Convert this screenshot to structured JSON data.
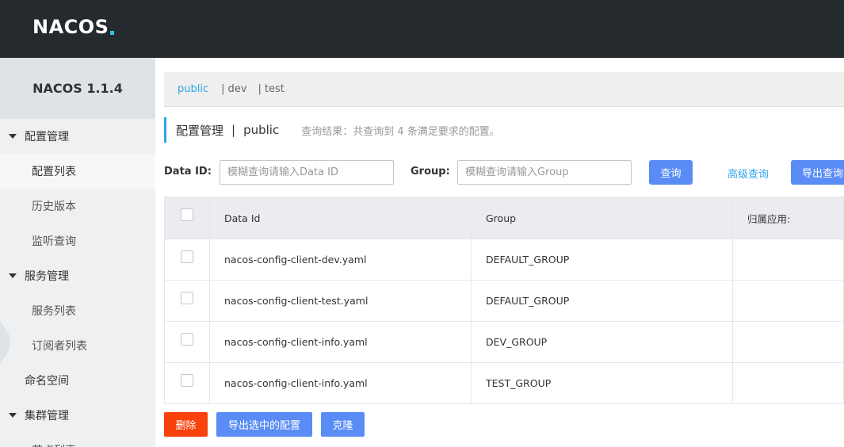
{
  "header": {
    "logo_text": "NACOS"
  },
  "sidebar": {
    "title": "NACOS 1.1.4",
    "config_group": "配置管理",
    "config_items": [
      "配置列表",
      "历史版本",
      "监听查询"
    ],
    "service_group": "服务管理",
    "service_items": [
      "服务列表",
      "订阅者列表"
    ],
    "namespace": "命名空间",
    "cluster_group": "集群管理",
    "cluster_items": [
      "节点列表"
    ]
  },
  "namespaces": {
    "items": [
      "public",
      "dev",
      "test"
    ],
    "active": "public"
  },
  "page": {
    "title": "配置管理",
    "separator": "|",
    "namespace": "public",
    "result": "查询结果：共查询到 4 条满足要求的配置。"
  },
  "search": {
    "dataid_label": "Data ID:",
    "dataid_placeholder": "模糊查询请输入Data ID",
    "group_label": "Group:",
    "group_placeholder": "模糊查询请输入Group",
    "query_btn": "查询",
    "advanced_link": "高级查询",
    "export_btn": "导出查询"
  },
  "table": {
    "columns": [
      "Data Id",
      "Group",
      "归属应用:"
    ],
    "rows": [
      {
        "data_id": "nacos-config-client-dev.yaml",
        "group": "DEFAULT_GROUP",
        "app": ""
      },
      {
        "data_id": "nacos-config-client-test.yaml",
        "group": "DEFAULT_GROUP",
        "app": ""
      },
      {
        "data_id": "nacos-config-client-info.yaml",
        "group": "DEV_GROUP",
        "app": ""
      },
      {
        "data_id": "nacos-config-client-info.yaml",
        "group": "TEST_GROUP",
        "app": ""
      }
    ]
  },
  "actions": {
    "delete": "删除",
    "export_selected": "导出选中的配置",
    "clone": "克隆"
  },
  "colors": {
    "accent": "#2fa4e7",
    "primary": "#5a8cf5",
    "danger": "#f8410b",
    "topbar": "#252a2f"
  }
}
